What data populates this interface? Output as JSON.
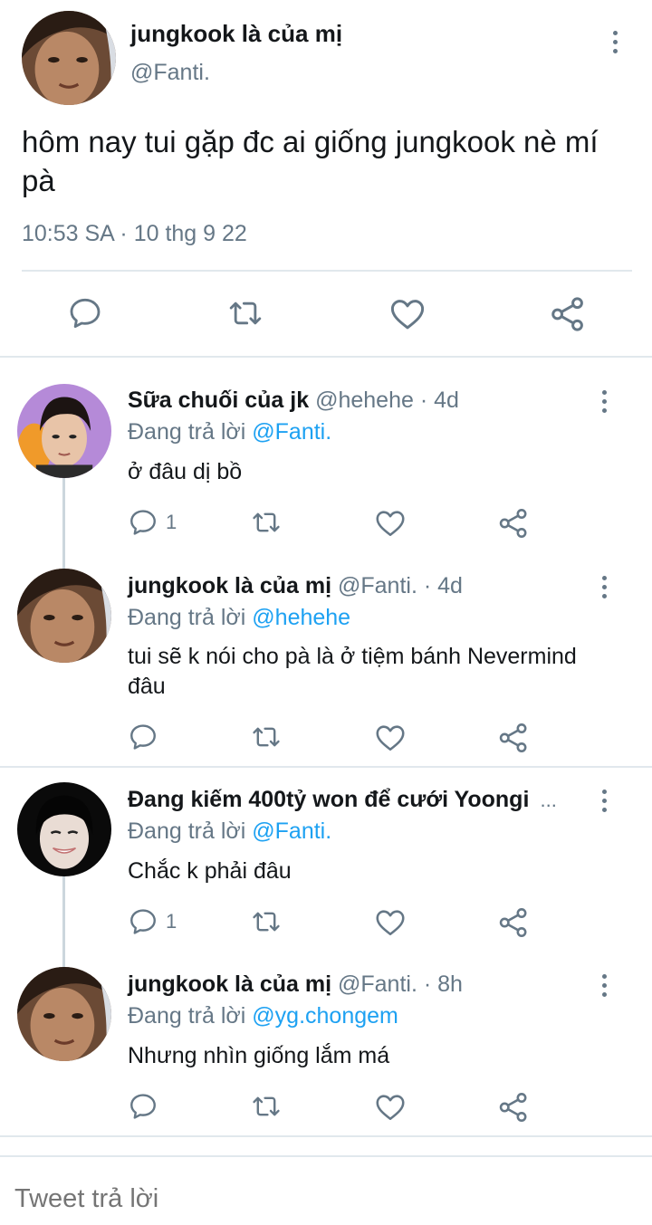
{
  "main_tweet": {
    "display_name": "jungkook là của mị",
    "handle": "@Fanti.",
    "text": "hôm nay tui gặp đc ai giống jungkook nè mí pà",
    "timestamp": "10:53 SA · 10 thg 9 22",
    "actions": [
      "reply-icon",
      "retweet-icon",
      "like-icon",
      "share-icon"
    ]
  },
  "replies": [
    {
      "display_name": "Sữa chuối của jk",
      "meta": " @hehehe · 4d",
      "replying_label": "Đang trả lời ",
      "replying_to": "@Fanti.",
      "text": "ở đâu dị bồ",
      "reply_count": "1"
    },
    {
      "display_name": "jungkook là của mị",
      "meta": " @Fanti. · 4d",
      "replying_label": "Đang trả lời ",
      "replying_to": "@hehehe",
      "text": "tui sẽ k nói cho pà là ở tiệm bánh Nevermind đâu",
      "reply_count": ""
    },
    {
      "display_name": "Đang kiếm 400tỷ won để cưới Yoongi",
      "meta": " ...",
      "replying_label": "Đang trả lời ",
      "replying_to": "@Fanti.",
      "text": "Chắc k phải đâu",
      "reply_count": "1"
    },
    {
      "display_name": "jungkook là của mị",
      "meta": " @Fanti. · 8h",
      "replying_label": "Đang trả lời ",
      "replying_to": "@yg.chongem",
      "text": "Nhưng nhìn giống lắm má",
      "reply_count": ""
    }
  ],
  "compose": {
    "placeholder": "Tweet trả lời"
  },
  "colors": {
    "text": "#14171a",
    "secondary": "#657786",
    "link": "#1da1f2",
    "divider": "#e1e8ed"
  }
}
